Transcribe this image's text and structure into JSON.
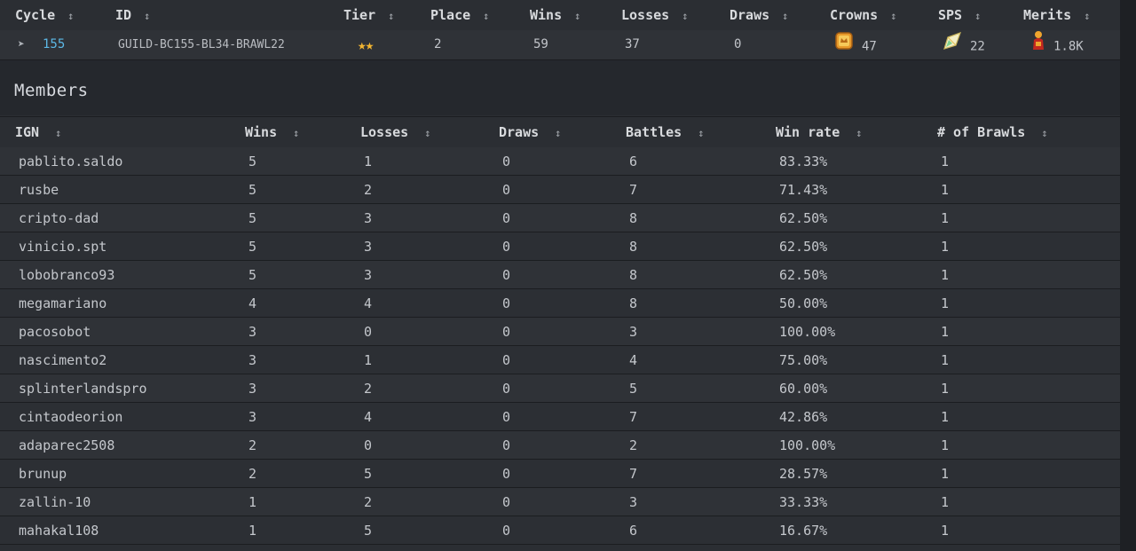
{
  "top_table": {
    "headers": [
      "Cycle",
      "ID",
      "Tier",
      "Place",
      "Wins",
      "Losses",
      "Draws",
      "Crowns",
      "SPS",
      "Merits"
    ],
    "sort_glyph": "↕",
    "row": {
      "cycle": "155",
      "id": "GUILD-BC155-BL34-BRAWL22",
      "tier_stars": "★★",
      "place": "2",
      "wins": "59",
      "losses": "37",
      "draws": "0",
      "crowns": "47",
      "sps": "22",
      "merits": "1.8K"
    },
    "icons": {
      "expand": "chevron-right-icon",
      "crowns": "crown-scroll-icon",
      "sps": "sps-crystal-icon",
      "merits": "merits-figure-icon"
    },
    "colors": {
      "link": "#5cb8e6",
      "star": "#f2b531"
    }
  },
  "members": {
    "title": "Members",
    "headers": [
      "IGN",
      "Wins",
      "Losses",
      "Draws",
      "Battles",
      "Win rate",
      "# of Brawls"
    ],
    "rows": [
      [
        "pablito.saldo",
        "5",
        "1",
        "0",
        "6",
        "83.33%",
        "1"
      ],
      [
        "rusbe",
        "5",
        "2",
        "0",
        "7",
        "71.43%",
        "1"
      ],
      [
        "cripto-dad",
        "5",
        "3",
        "0",
        "8",
        "62.50%",
        "1"
      ],
      [
        "vinicio.spt",
        "5",
        "3",
        "0",
        "8",
        "62.50%",
        "1"
      ],
      [
        "lobobranco93",
        "5",
        "3",
        "0",
        "8",
        "62.50%",
        "1"
      ],
      [
        "megamariano",
        "4",
        "4",
        "0",
        "8",
        "50.00%",
        "1"
      ],
      [
        "pacosobot",
        "3",
        "0",
        "0",
        "3",
        "100.00%",
        "1"
      ],
      [
        "nascimento2",
        "3",
        "1",
        "0",
        "4",
        "75.00%",
        "1"
      ],
      [
        "splinterlandspro",
        "3",
        "2",
        "0",
        "5",
        "60.00%",
        "1"
      ],
      [
        "cintaodeorion",
        "3",
        "4",
        "0",
        "7",
        "42.86%",
        "1"
      ],
      [
        "adaparec2508",
        "2",
        "0",
        "0",
        "2",
        "100.00%",
        "1"
      ],
      [
        "brunup",
        "2",
        "5",
        "0",
        "7",
        "28.57%",
        "1"
      ],
      [
        "zallin-10",
        "1",
        "2",
        "0",
        "3",
        "33.33%",
        "1"
      ],
      [
        "mahakal108",
        "1",
        "5",
        "0",
        "6",
        "16.67%",
        "1"
      ]
    ]
  }
}
